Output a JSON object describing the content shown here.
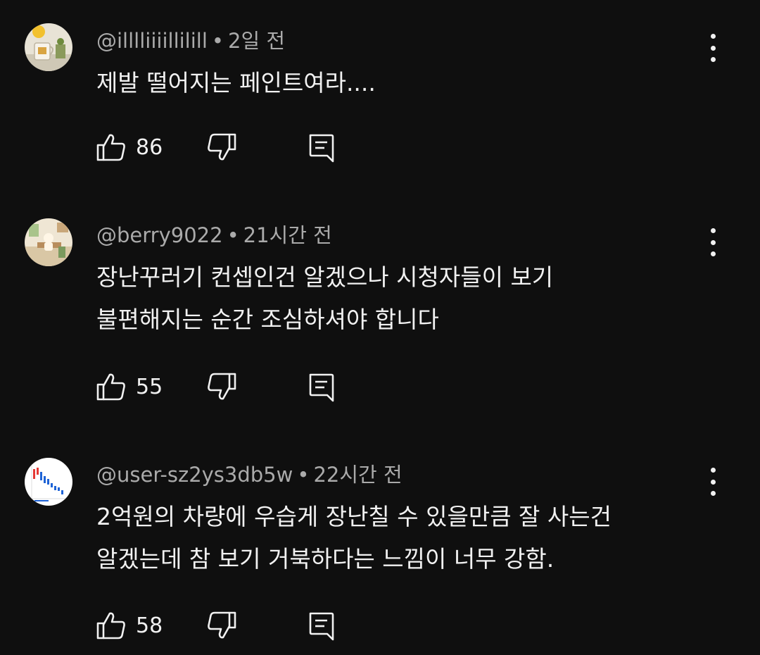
{
  "comments": [
    {
      "author": "@illlliiiillilill",
      "time": "2일 전",
      "text_lines": [
        "제발 떨어지는 페인트여라...."
      ],
      "likes": "86",
      "avatar": "mug-photo-avatar"
    },
    {
      "author": "@berry9022",
      "time": "21시간 전",
      "text_lines": [
        "장난꾸러기 컨셉인건 알겠으나 시청자들이 보기",
        "불편해지는 순간 조심하셔야 합니다"
      ],
      "likes": "55",
      "avatar": "room-illustration-avatar"
    },
    {
      "author": "@user-sz2ys3db5w",
      "time": "22시간 전",
      "text_lines": [
        "2억원의 차량에 우습게 장난칠 수 있을만큼 잘 사는건",
        "알겠는데 참 보기 거북하다는 느낌이 너무 강함."
      ],
      "likes": "58",
      "avatar": "stock-chart-avatar"
    }
  ],
  "separator": "•",
  "icons": {
    "like": "thumb-up-icon",
    "dislike": "thumb-down-icon",
    "reply": "reply-icon",
    "more": "more-vert-icon"
  },
  "colors": {
    "background": "#0f0f0f",
    "text": "#f1f1f1",
    "meta": "#aaaaaa"
  }
}
